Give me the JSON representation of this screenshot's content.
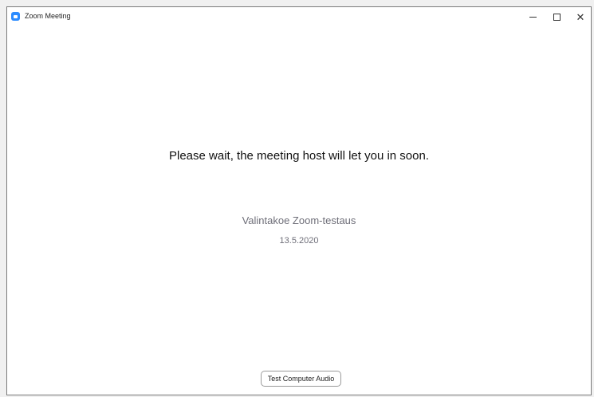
{
  "window": {
    "title": "Zoom Meeting",
    "controls": {
      "minimize_icon": "minimize-icon",
      "maximize_icon": "maximize-icon",
      "close_icon": "close-icon"
    }
  },
  "main": {
    "wait_message": "Please wait, the meeting host will let you in soon.",
    "meeting_title": "Valintakoe Zoom-testaus",
    "meeting_date": "13.5.2020"
  },
  "footer": {
    "test_audio_label": "Test Computer Audio"
  },
  "colors": {
    "brand_blue": "#2d8cff",
    "muted_text": "#6e6e78"
  }
}
